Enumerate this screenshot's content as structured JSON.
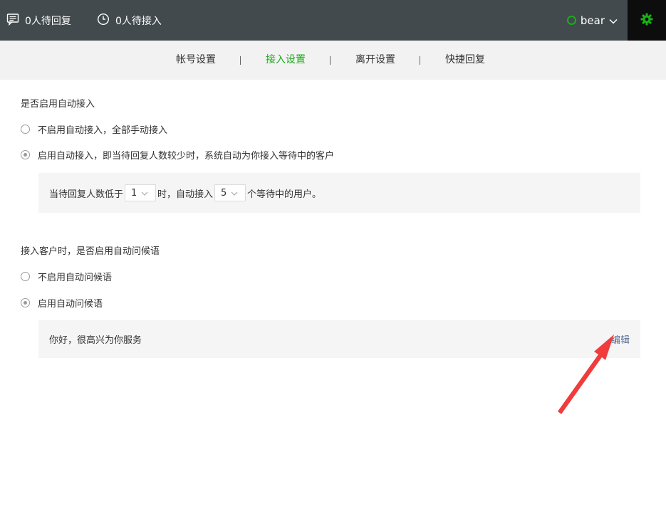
{
  "header": {
    "pending_reply": "0人待回复",
    "pending_access": "0人待接入",
    "user_name": "bear"
  },
  "tabs": [
    "帐号设置",
    "接入设置",
    "离开设置",
    "快捷回复"
  ],
  "active_tab": "接入设置",
  "auto_access": {
    "title": "是否启用自动接入",
    "option_off": "不启用自动接入，全部手动接入",
    "option_on": "启用自动接入，即当待回复人数较少时，系统自动为你接入等待中的客户",
    "selected": "on",
    "rule": {
      "prefix": "当待回复人数低于",
      "threshold": "1",
      "middle": "时，自动接入",
      "count": "5",
      "suffix": "个等待中的用户。"
    }
  },
  "greeting": {
    "title": "接入客户时，是否启用自动问候语",
    "option_off": "不启用自动问候语",
    "option_on": "启用自动问候语",
    "selected": "on",
    "message": "你好，很高兴为你服务",
    "edit_label": "编辑"
  },
  "colors": {
    "accent_green": "#1aad19",
    "topbar_bg": "#424a4d",
    "link_blue": "#576b95",
    "annotation_red": "#f03c3c"
  }
}
